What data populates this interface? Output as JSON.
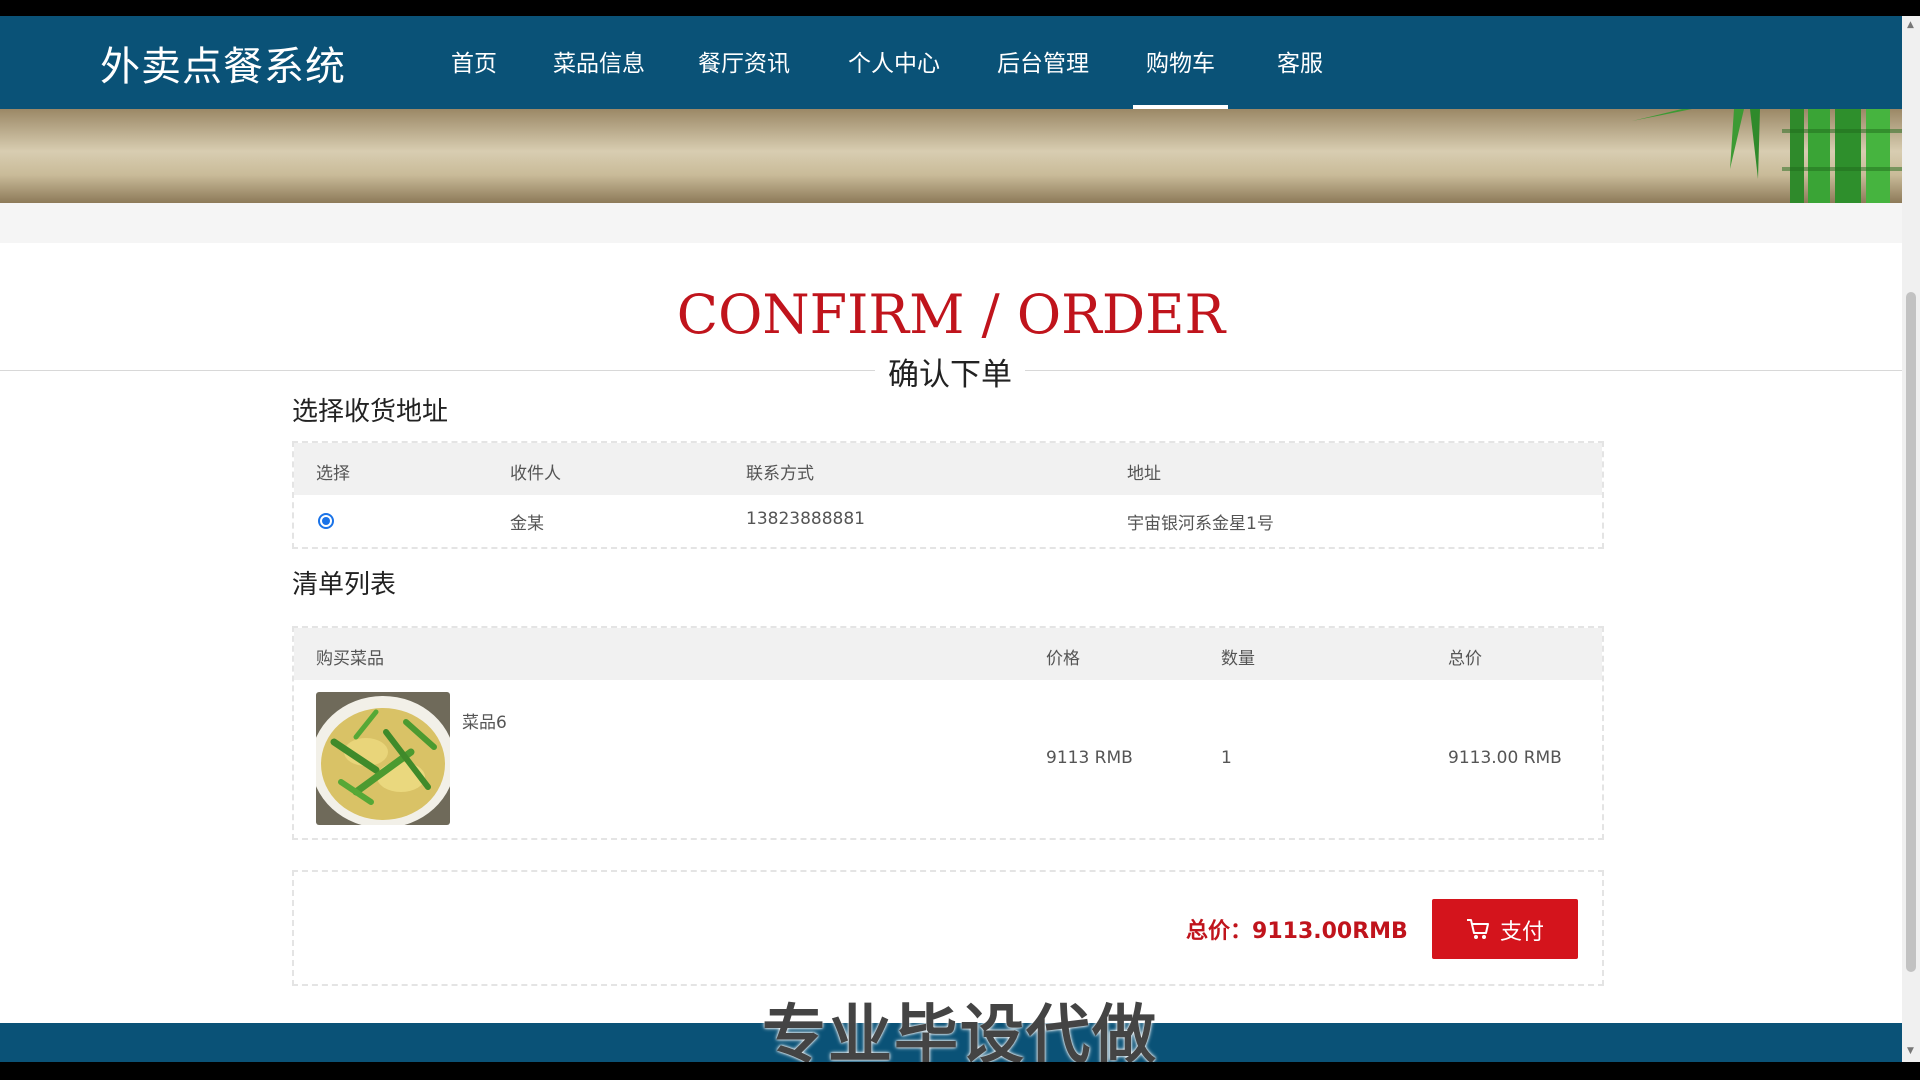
{
  "brand": "外卖点餐系统",
  "nav": [
    {
      "label": "首页"
    },
    {
      "label": "菜品信息"
    },
    {
      "label": "餐厅资讯"
    },
    {
      "label": "个人中心"
    },
    {
      "label": "后台管理"
    },
    {
      "label": "购物车",
      "active": true
    },
    {
      "label": "客服"
    }
  ],
  "page": {
    "title_en": "CONFIRM / ORDER",
    "title_cn": "确认下单"
  },
  "address": {
    "section_title": "选择收货地址",
    "headers": [
      "选择",
      "收件人",
      "联系方式",
      "地址"
    ],
    "rows": [
      {
        "selected": true,
        "recipient": "金某",
        "phone": "13823888881",
        "address": "宇宙银河系金星1号"
      }
    ]
  },
  "items": {
    "section_title": "清单列表",
    "headers": [
      "购买菜品",
      "价格",
      "数量",
      "总价"
    ],
    "rows": [
      {
        "name": "菜品6",
        "price": "9113 RMB",
        "quantity": "1",
        "subtotal": "9113.00 RMB"
      }
    ]
  },
  "checkout": {
    "total_label": "总价：",
    "total_value": "9113.00RMB",
    "pay_label": "支付"
  },
  "overlay_text": "专业毕设代做",
  "colors": {
    "header_bg": "#0a5277",
    "accent_red": "#c0141c",
    "pay_button": "#d4141c",
    "radio_blue": "#1a73e8"
  }
}
